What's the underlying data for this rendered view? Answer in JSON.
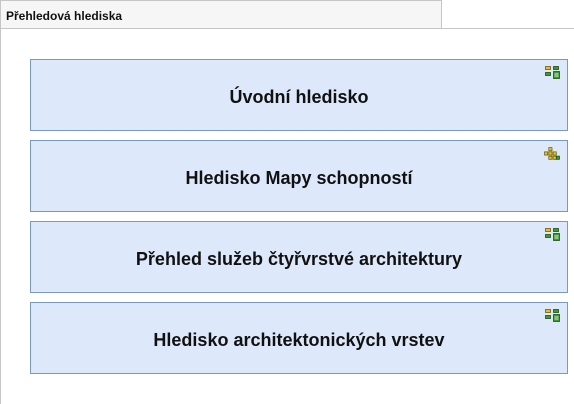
{
  "tab": {
    "label": "Přehledová hlediska"
  },
  "cards": [
    {
      "label": "Úvodní hledisko",
      "icon": "viewpoint-icon"
    },
    {
      "label": "Hledisko Mapy schopností",
      "icon": "capability-map-icon"
    },
    {
      "label": "Přehled služeb čtyřvrstvé architektury",
      "icon": "viewpoint-icon"
    },
    {
      "label": "Hledisko architektonických vrstev",
      "icon": "viewpoint-icon"
    }
  ],
  "colors": {
    "card_fill": "#dde9fb",
    "card_border": "#7a98c5",
    "icon_green": "#3c9a2e",
    "icon_yellow": "#e8c21a"
  }
}
